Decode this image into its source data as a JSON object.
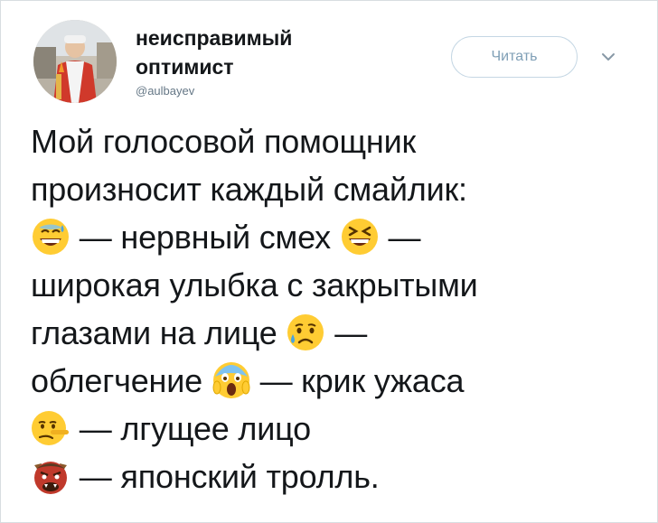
{
  "profile": {
    "display_name": "неисправимый оптимист",
    "handle": "@aulbayev"
  },
  "follow_button": {
    "label": "Читать"
  },
  "menu_caret_icon": "chevron-down-icon",
  "tweet": {
    "lines": [
      {
        "text": "Мой голосовой помощник"
      },
      {
        "text": "произносит каждый смайлик:"
      },
      {
        "emoji_a": "grinning-face-with-sweat",
        "text_a": " — нервный смех ",
        "emoji_b": "grinning-squinting-face",
        "text_b": " —"
      },
      {
        "text": "широкая улыбка с закрытыми"
      },
      {
        "text_a": "глазами на лице ",
        "emoji_a": "sad-but-relieved-face",
        "text_b": " —"
      },
      {
        "text_a": "облегчение ",
        "emoji_a": "face-screaming-in-fear",
        "text_b": " — крик ужаса"
      },
      {
        "emoji_a": "lying-face",
        "text_a": " — лгущее лицо"
      },
      {
        "emoji_a": "ogre",
        "text_a": " — японский тролль."
      }
    ]
  },
  "colors": {
    "text": "#14171a",
    "secondary": "#657786",
    "button_text": "#7f9fb6",
    "button_border": "#c5d7e4",
    "frame": "#d8dde1"
  }
}
